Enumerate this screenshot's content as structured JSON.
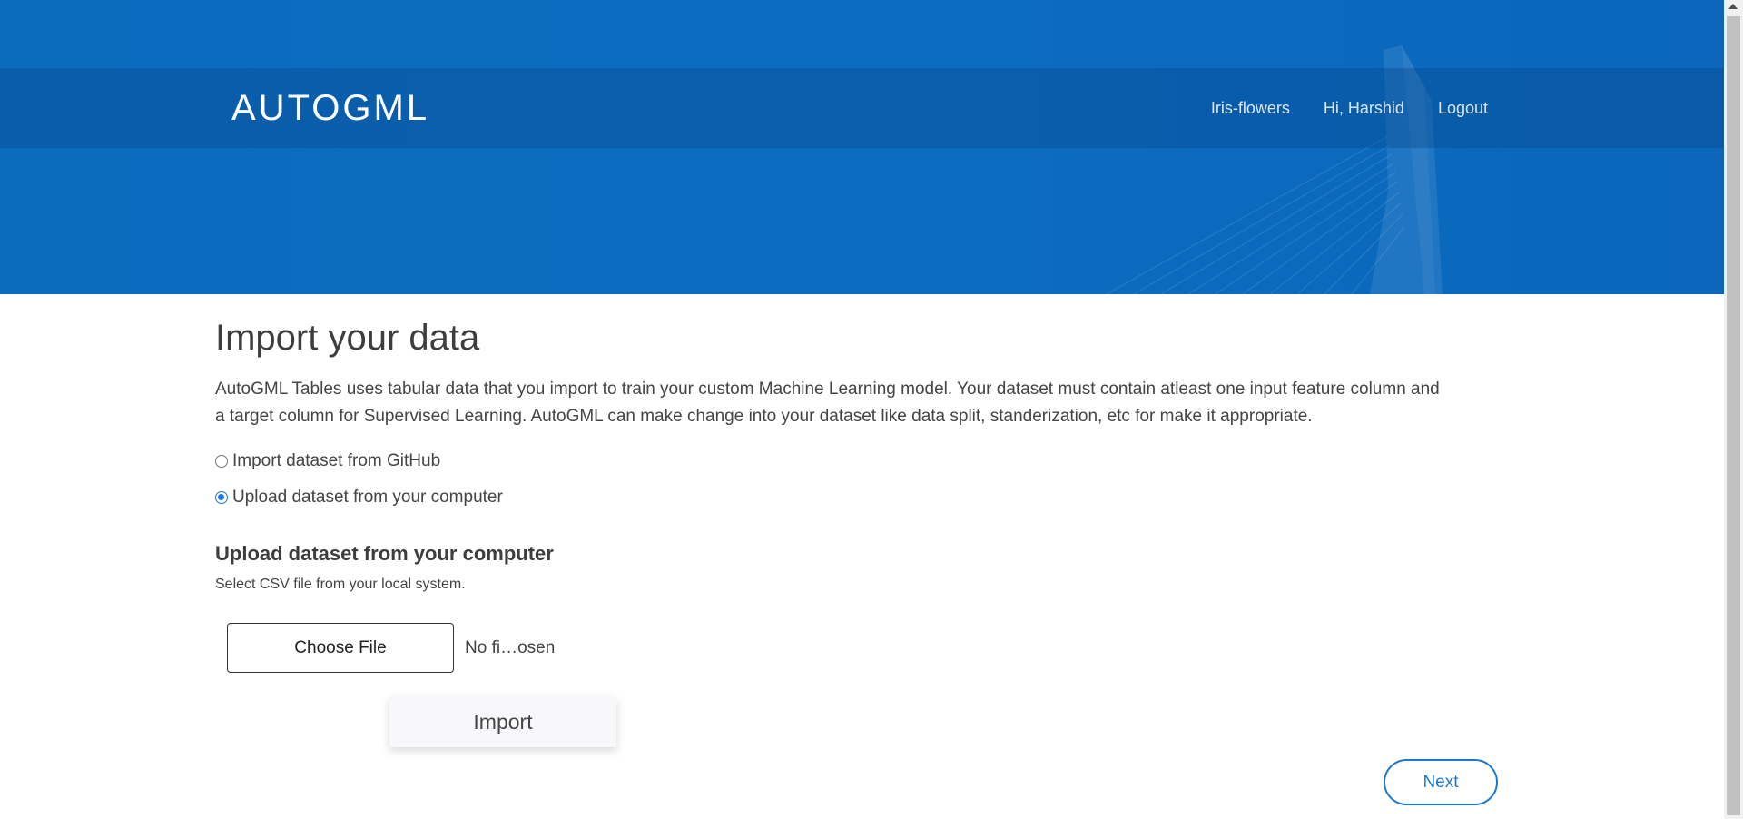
{
  "header": {
    "brand": "AUTOGML",
    "nav": [
      {
        "label": "Iris-flowers"
      },
      {
        "label": "Hi, Harshid"
      },
      {
        "label": "Logout"
      }
    ]
  },
  "main": {
    "title": "Import your data",
    "description_line1": "AutoGML Tables uses tabular data that you import to train your custom Machine Learning model. Your dataset must contain atleast one input feature column and",
    "description_line2": "a target column for Supervised Learning. AutoGML can make change into your dataset like data split, standerization, etc for make it appropriate.",
    "options": [
      {
        "label": "Import dataset from GitHub",
        "checked": false
      },
      {
        "label": "Upload dataset from your computer",
        "checked": true
      }
    ],
    "upload": {
      "heading": "Upload dataset from your computer",
      "hint": "Select CSV file from your local system.",
      "choose_label": "Choose File",
      "file_status": "No fi…osen",
      "import_label": "Import"
    },
    "next_label": "Next"
  },
  "colors": {
    "hero": "#0c6cc0",
    "accent": "#1a78d1",
    "radio_checked": "#1a73e8"
  }
}
